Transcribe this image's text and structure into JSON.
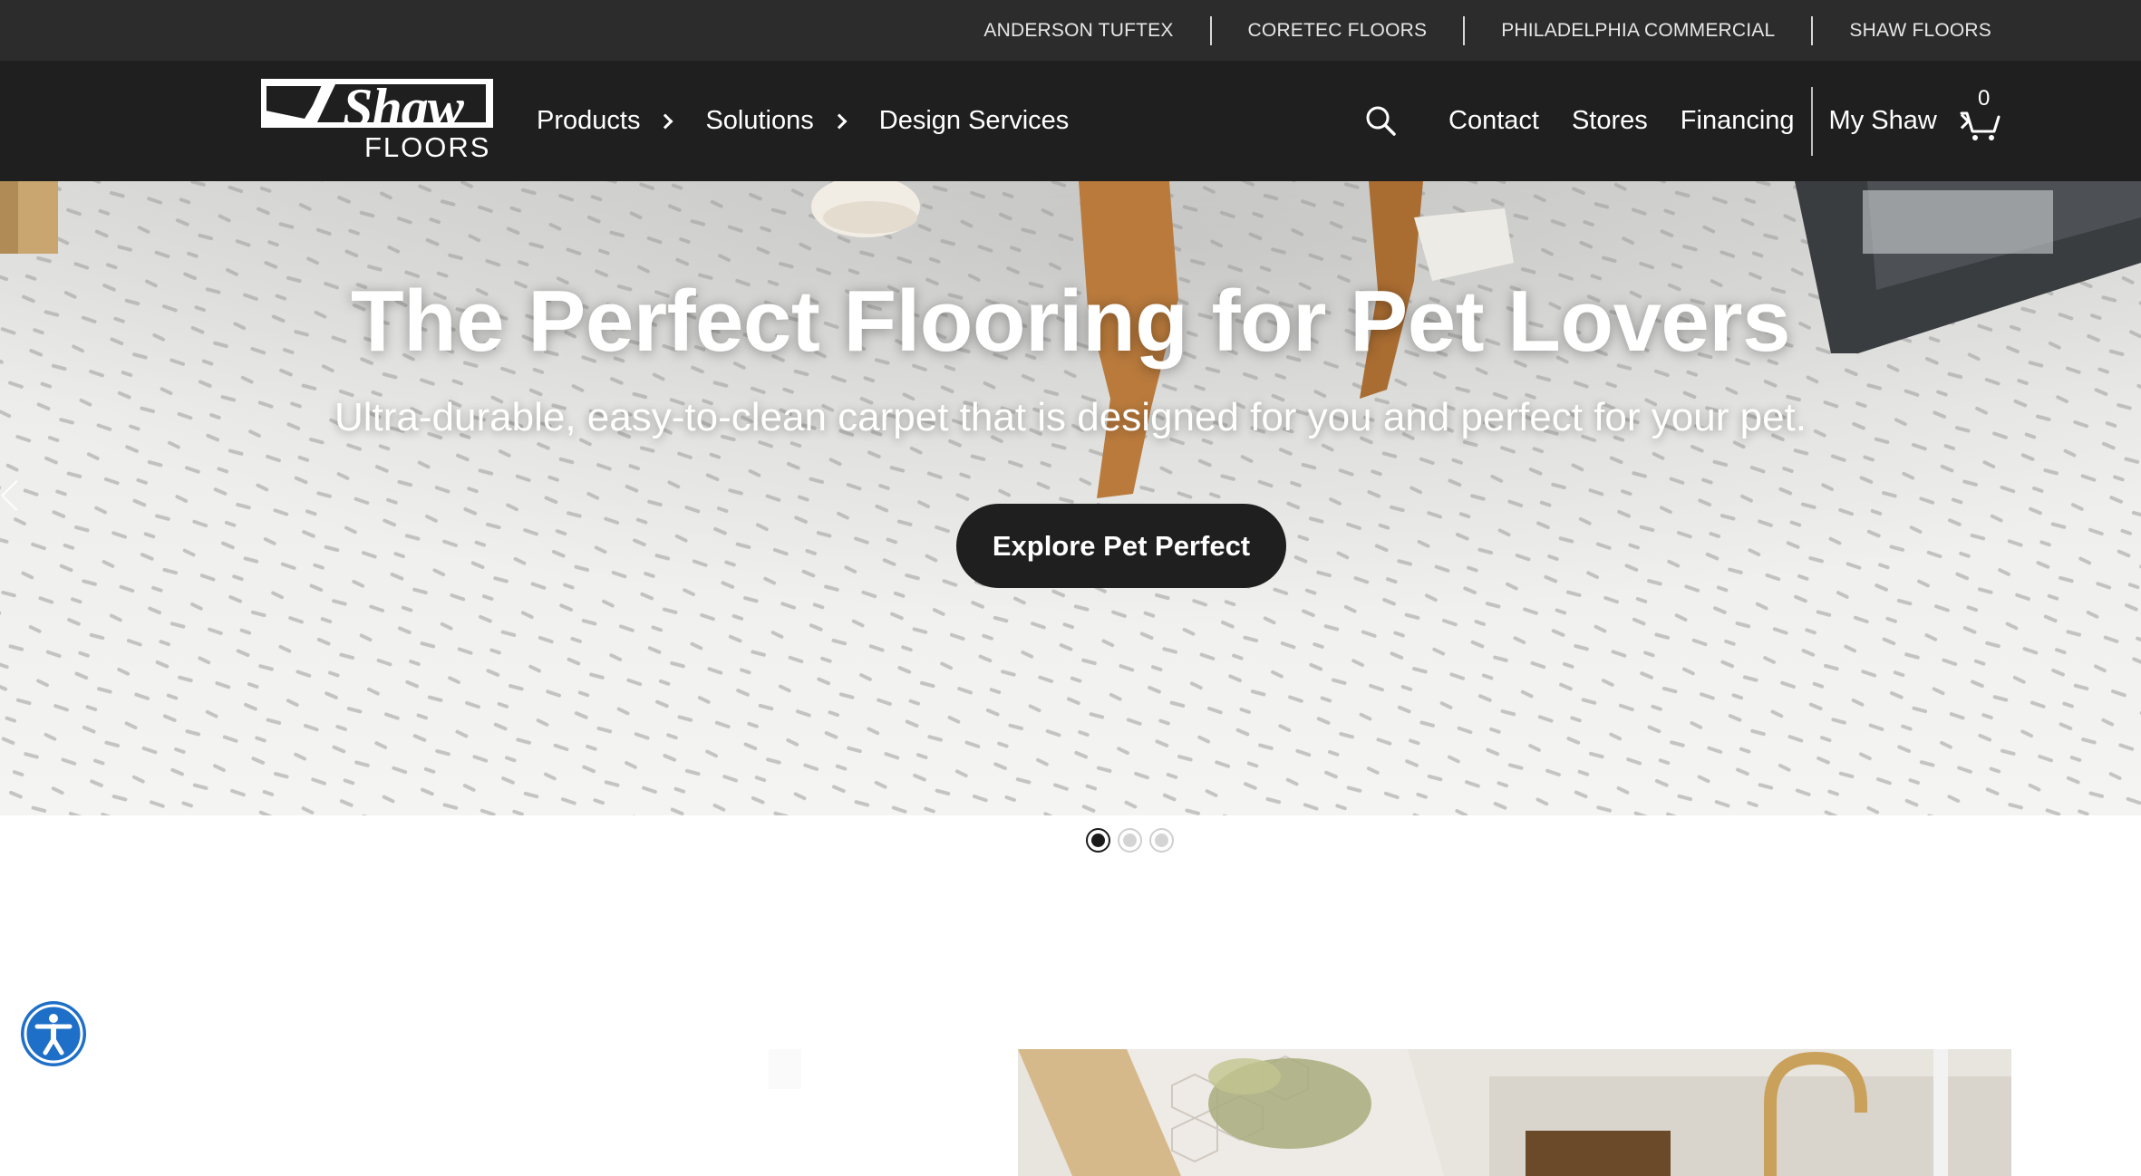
{
  "utility_bar": {
    "links": [
      "ANDERSON TUFTEX",
      "CORETEC FLOORS",
      "PHILADELPHIA COMMERCIAL",
      "SHAW FLOORS"
    ]
  },
  "logo": {
    "word": "Shaw",
    "sub": "FLOORS"
  },
  "nav": {
    "products": "Products",
    "solutions": "Solutions",
    "design_services": "Design Services",
    "contact": "Contact",
    "stores": "Stores",
    "financing": "Financing",
    "my_shaw": "My Shaw",
    "cart_count": "0",
    "icons": [
      "search-icon",
      "cart-icon",
      "chevron-right-icon"
    ]
  },
  "hero": {
    "title": "The Perfect Flooring for Pet Lovers",
    "subtitle": "Ultra-durable, easy-to-clean carpet that is designed for you and perfect for your pet.",
    "cta": "Explore Pet Perfect",
    "slides_total": 3,
    "active_slide": 1
  },
  "colors": {
    "utility_bg": "#2c2c2c",
    "nav_bg": "#1f1f1f",
    "cta_bg": "#1f1f1f",
    "accessibility_blue": "#1e6fc8"
  }
}
